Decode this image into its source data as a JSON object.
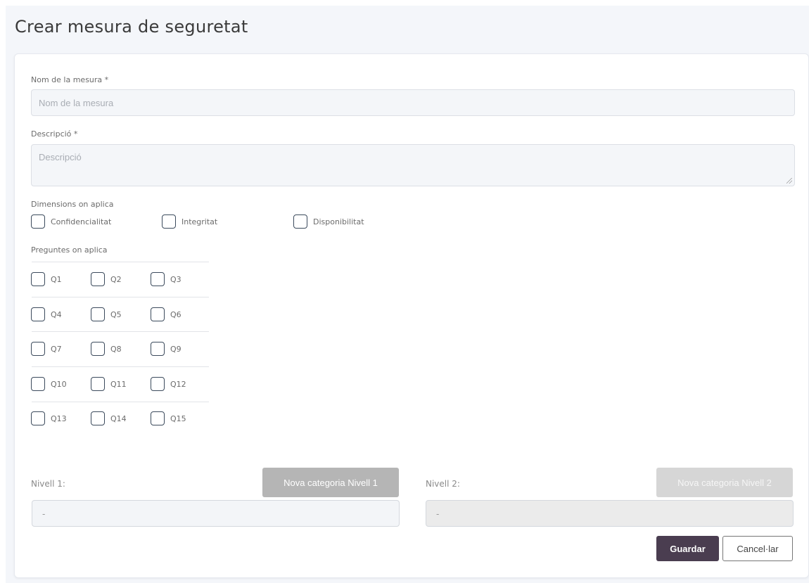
{
  "page": {
    "title": "Crear mesura de seguretat"
  },
  "form": {
    "name": {
      "label": "Nom de la mesura *",
      "placeholder": "Nom de la mesura",
      "value": ""
    },
    "description": {
      "label": "Descripció *",
      "placeholder": "Descripció",
      "value": ""
    },
    "dimensions": {
      "label": "Dimensions on aplica",
      "options": [
        "Confidencialitat",
        "Integritat",
        "Disponibilitat"
      ]
    },
    "questions": {
      "label": "Preguntes on aplica",
      "rows": [
        [
          "Q1",
          "Q2",
          "Q3"
        ],
        [
          "Q4",
          "Q5",
          "Q6"
        ],
        [
          "Q7",
          "Q8",
          "Q9"
        ],
        [
          "Q10",
          "Q11",
          "Q12"
        ],
        [
          "Q13",
          "Q14",
          "Q15"
        ]
      ]
    },
    "level1": {
      "label": "Nivell 1:",
      "button": "Nova categoria Nivell 1",
      "value": "-"
    },
    "level2": {
      "label": "Nivell 2:",
      "button": "Nova categoria Nivell 2",
      "value": "-"
    }
  },
  "actions": {
    "save": "Guardar",
    "cancel": "Cancel·lar"
  },
  "colors": {
    "save_bg": "#4a3d50",
    "checkbox_border": "#3b4a5c"
  }
}
